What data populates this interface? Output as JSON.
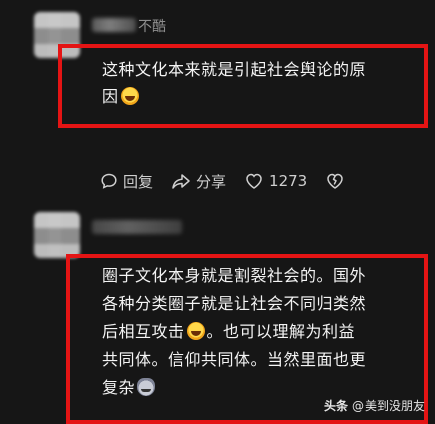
{
  "comment1": {
    "username": "不酷",
    "text_line1": "这种文化本来就是引起社会舆论的原",
    "text_line2": "因"
  },
  "actions": {
    "reply_label": "回复",
    "share_label": "分享",
    "like_count": "1273"
  },
  "comment2": {
    "line1": "圈子文化本身就是割裂社会的。国外",
    "line2": "各种分类圈子就是让社会不同归类然",
    "line3_a": "后相互攻击",
    "line3_b": "。也可以理解为利益",
    "line4": "共同体。信仰共同体。当然里面也更",
    "line5": "复杂"
  },
  "watermark": {
    "logo": "头条",
    "at": "@",
    "author": "美到没朋友"
  },
  "colors": {
    "highlight_box": "#e41414",
    "background": "#161616"
  }
}
